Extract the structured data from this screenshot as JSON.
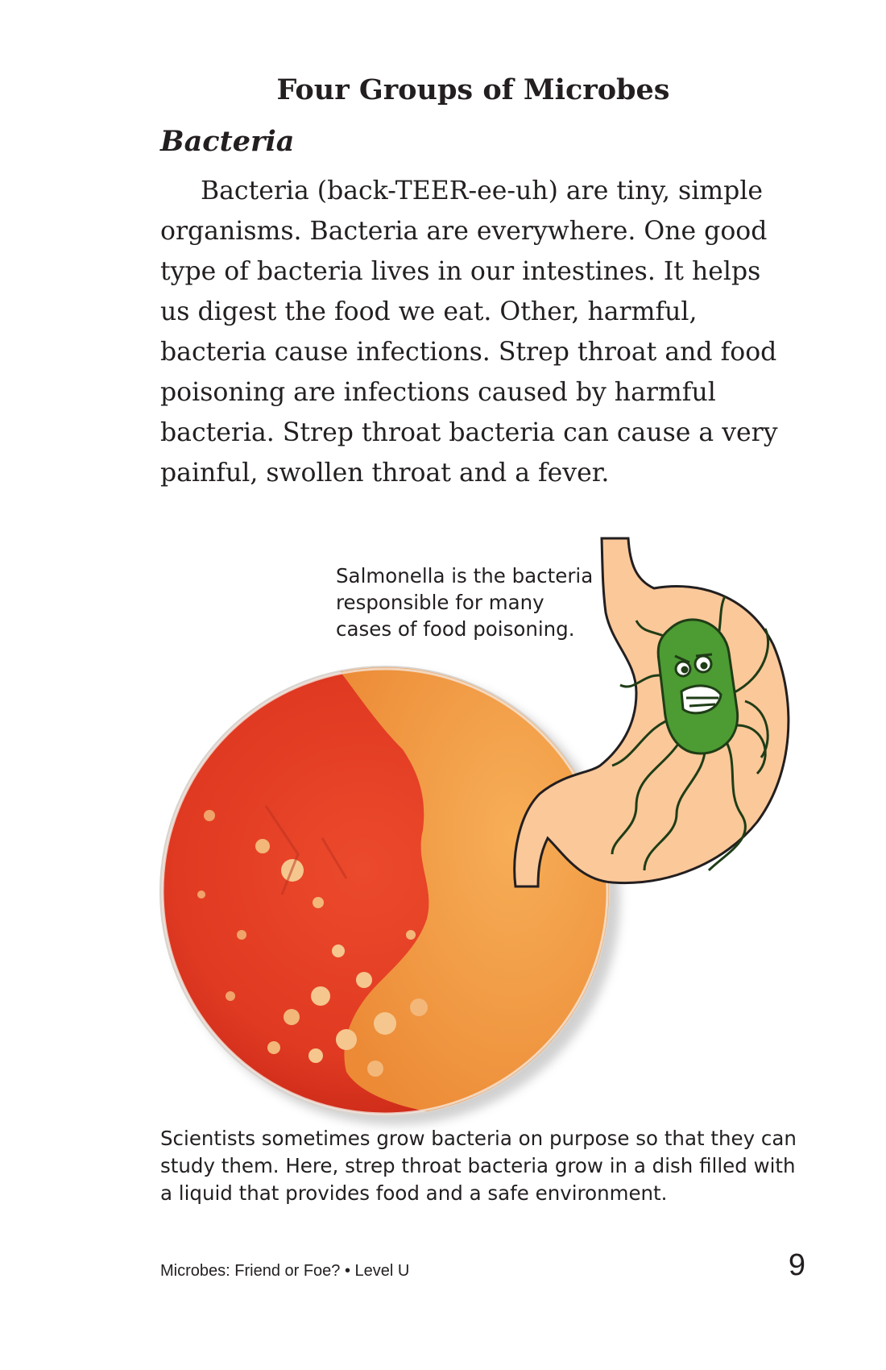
{
  "heading": {
    "title": "Four Groups of Microbes",
    "subheading": "Bacteria"
  },
  "body": {
    "paragraph": "Bacteria (back-TEER-ee-uh) are tiny, simple organisms. Bacteria are everywhere. One good type of bacteria lives in our intestines. It helps us digest the food we eat. Other, harmful, bacteria cause infections. Strep throat and food poisoning are infections caused by harmful bacteria. Strep throat bacteria can cause a very painful, swollen throat and a fever."
  },
  "figure": {
    "callout": "Salmonella is the bacteria\nresponsible for many\ncases of food poisoning.",
    "caption": "Scientists sometimes grow bacteria on purpose so that they can\nstudy them. Here, strep throat bacteria grow in a dish filled with\na liquid that provides food and a safe environment."
  },
  "footer": {
    "book_title": "Microbes: Friend or Foe? • Level U",
    "page_number": "9"
  },
  "colors": {
    "dish_red": "#e33a22",
    "colony_orange": "#f29a3c",
    "stomach": "#fbc89a",
    "germ_green": "#3f8a2a"
  }
}
